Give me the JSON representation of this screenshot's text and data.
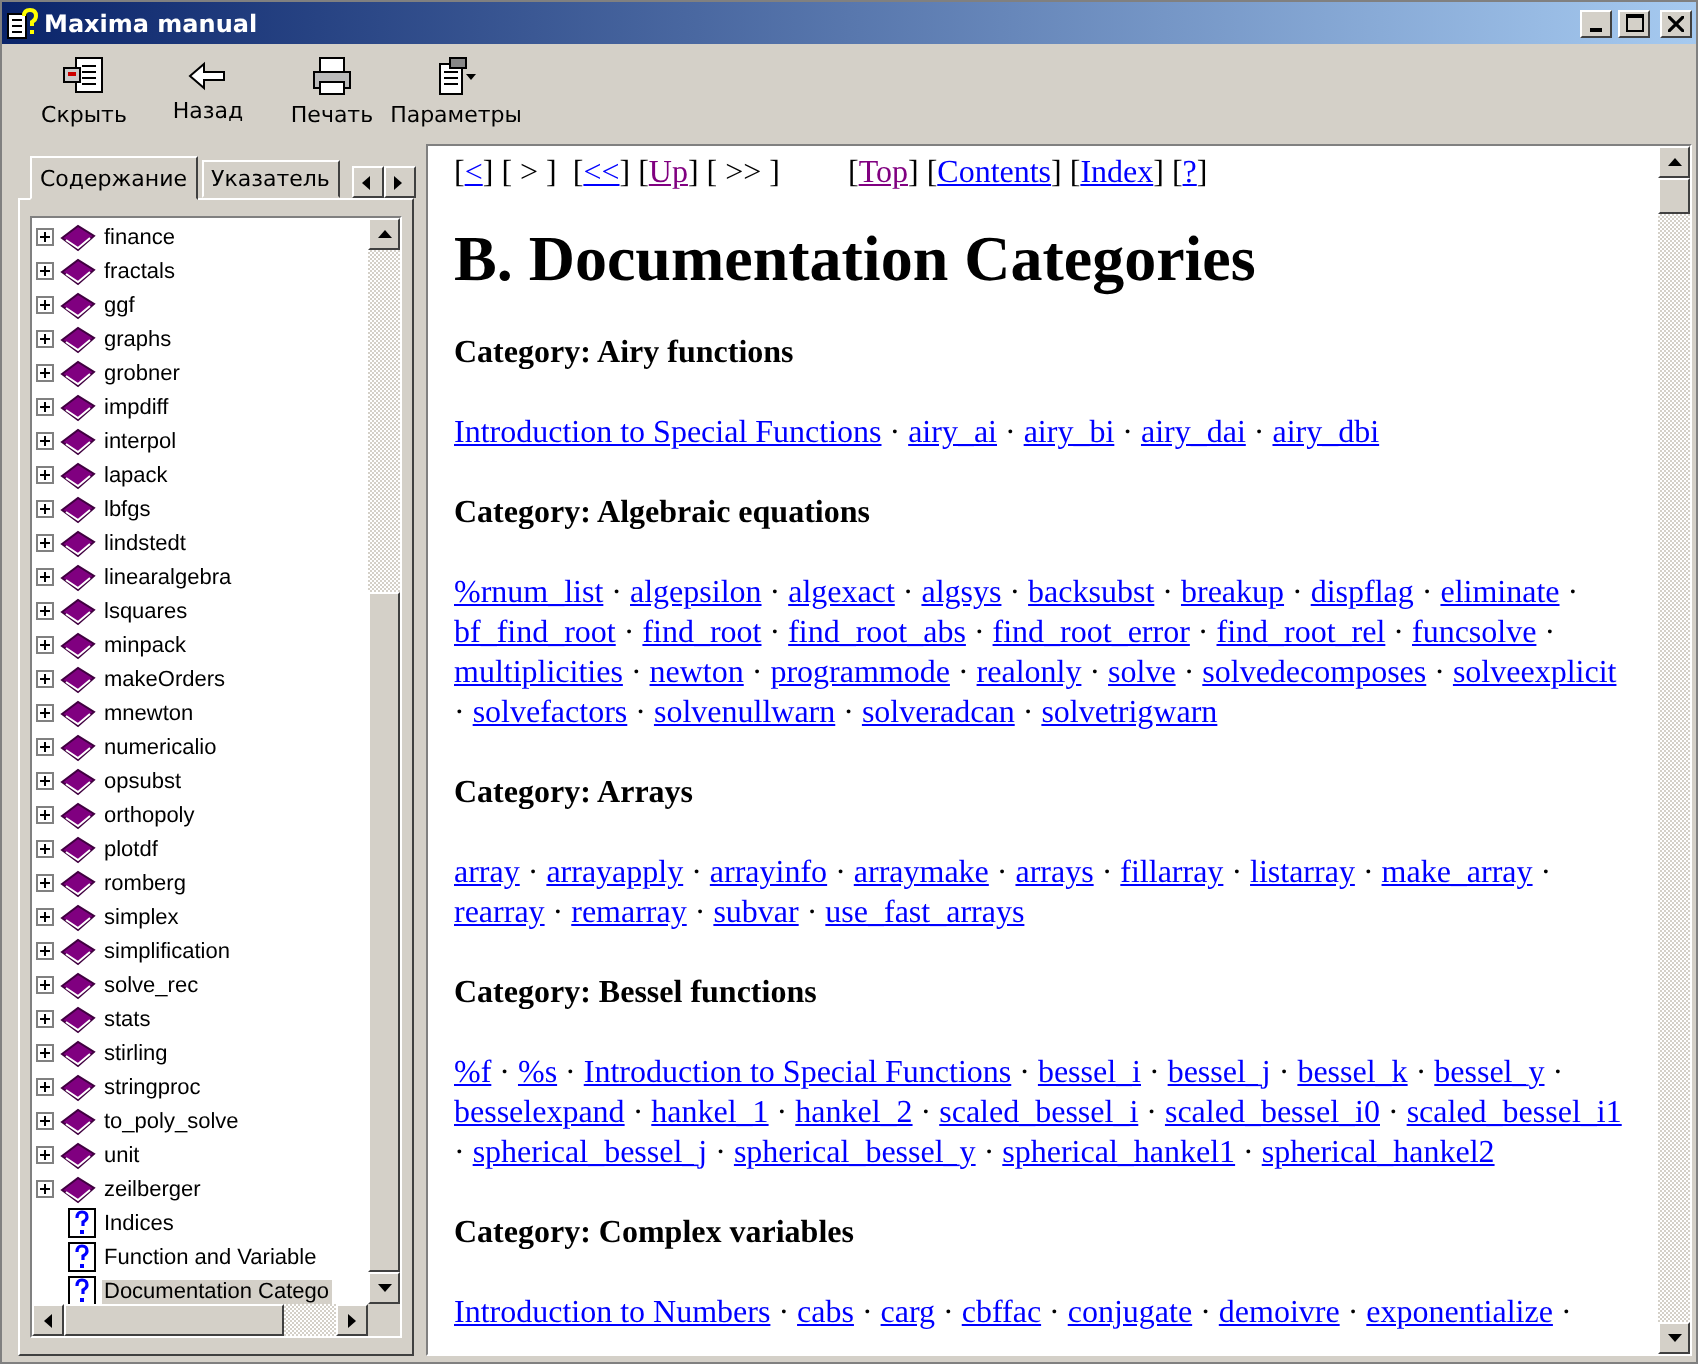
{
  "window": {
    "title": "Maxima manual"
  },
  "toolbar": [
    {
      "label": "Скрыть",
      "kind": "hide"
    },
    {
      "label": "Назад",
      "kind": "back"
    },
    {
      "label": "Печать",
      "kind": "print"
    },
    {
      "label": "Параметры",
      "kind": "options"
    }
  ],
  "tabs": [
    {
      "label": "Содержание",
      "selected": true
    },
    {
      "label": "Указатель",
      "selected": false
    }
  ],
  "tree": {
    "items": [
      {
        "label": "finance",
        "kind": "book",
        "selected": false
      },
      {
        "label": "fractals",
        "kind": "book",
        "selected": false
      },
      {
        "label": "ggf",
        "kind": "book",
        "selected": false
      },
      {
        "label": "graphs",
        "kind": "book",
        "selected": false
      },
      {
        "label": "grobner",
        "kind": "book",
        "selected": false
      },
      {
        "label": "impdiff",
        "kind": "book",
        "selected": false
      },
      {
        "label": "interpol",
        "kind": "book",
        "selected": false
      },
      {
        "label": "lapack",
        "kind": "book",
        "selected": false
      },
      {
        "label": "lbfgs",
        "kind": "book",
        "selected": false
      },
      {
        "label": "lindstedt",
        "kind": "book",
        "selected": false
      },
      {
        "label": "linearalgebra",
        "kind": "book",
        "selected": false
      },
      {
        "label": "lsquares",
        "kind": "book",
        "selected": false
      },
      {
        "label": "minpack",
        "kind": "book",
        "selected": false
      },
      {
        "label": "makeOrders",
        "kind": "book",
        "selected": false
      },
      {
        "label": "mnewton",
        "kind": "book",
        "selected": false
      },
      {
        "label": "numericalio",
        "kind": "book",
        "selected": false
      },
      {
        "label": "opsubst",
        "kind": "book",
        "selected": false
      },
      {
        "label": "orthopoly",
        "kind": "book",
        "selected": false
      },
      {
        "label": "plotdf",
        "kind": "book",
        "selected": false
      },
      {
        "label": "romberg",
        "kind": "book",
        "selected": false
      },
      {
        "label": "simplex",
        "kind": "book",
        "selected": false
      },
      {
        "label": "simplification",
        "kind": "book",
        "selected": false
      },
      {
        "label": "solve_rec",
        "kind": "book",
        "selected": false
      },
      {
        "label": "stats",
        "kind": "book",
        "selected": false
      },
      {
        "label": "stirling",
        "kind": "book",
        "selected": false
      },
      {
        "label": "stringproc",
        "kind": "book",
        "selected": false
      },
      {
        "label": "to_poly_solve",
        "kind": "book",
        "selected": false
      },
      {
        "label": "unit",
        "kind": "book",
        "selected": false
      },
      {
        "label": "zeilberger",
        "kind": "book",
        "selected": false
      },
      {
        "label": "Indices",
        "kind": "page",
        "selected": false
      },
      {
        "label": "Function and Variable",
        "kind": "page",
        "selected": false
      },
      {
        "label": "Documentation Catego",
        "kind": "page",
        "selected": true
      }
    ]
  },
  "nav": [
    [
      {
        "text": "[",
        "kind": "text"
      },
      {
        "text": "<",
        "kind": "link",
        "visited": false
      },
      {
        "text": "] [ > ]",
        "kind": "text"
      }
    ],
    [
      {
        "text": "[",
        "kind": "text"
      },
      {
        "text": "<<",
        "kind": "link",
        "visited": false
      },
      {
        "text": "] [",
        "kind": "text"
      },
      {
        "text": "Up",
        "kind": "link",
        "visited": true
      },
      {
        "text": "] [ >> ]",
        "kind": "text"
      }
    ],
    [
      {
        "text": "[",
        "kind": "text"
      },
      {
        "text": "Top",
        "kind": "link",
        "visited": true
      },
      {
        "text": "] [",
        "kind": "text"
      },
      {
        "text": "Contents",
        "kind": "link",
        "visited": false
      },
      {
        "text": "] [",
        "kind": "text"
      },
      {
        "text": "Index",
        "kind": "link",
        "visited": false
      },
      {
        "text": "] [",
        "kind": "text"
      },
      {
        "text": "?",
        "kind": "link",
        "visited": false
      },
      {
        "text": "]",
        "kind": "text"
      }
    ]
  ],
  "heading": "B. Documentation Categories",
  "separator": "·",
  "categories": [
    {
      "title": "Category: Airy functions",
      "links": [
        "Introduction to Special Functions",
        "airy_ai",
        "airy_bi",
        "airy_dai",
        "airy_dbi"
      ]
    },
    {
      "title": "Category: Algebraic equations",
      "links": [
        "%rnum_list",
        "algepsilon",
        "algexact",
        "algsys",
        "backsubst",
        "breakup",
        "dispflag",
        "eliminate",
        "bf_find_root",
        "find_root",
        "find_root_abs",
        "find_root_error",
        "find_root_rel",
        "funcsolve",
        "multiplicities",
        "newton",
        "programmode",
        "realonly",
        "solve",
        "solvedecomposes",
        "solveexplicit",
        "solvefactors",
        "solvenullwarn",
        "solveradcan",
        "solvetrigwarn"
      ]
    },
    {
      "title": "Category: Arrays",
      "links": [
        "array",
        "arrayapply",
        "arrayinfo",
        "arraymake",
        "arrays",
        "fillarray",
        "listarray",
        "make_array",
        "rearray",
        "remarray",
        "subvar",
        "use_fast_arrays"
      ]
    },
    {
      "title": "Category: Bessel functions",
      "links": [
        "%f",
        "%s",
        "Introduction to Special Functions",
        "bessel_i",
        "bessel_j",
        "bessel_k",
        "bessel_y",
        "besselexpand",
        "hankel_1",
        "hankel_2",
        "scaled_bessel_i",
        "scaled_bessel_i0",
        "scaled_bessel_i1",
        "spherical_bessel_j",
        "spherical_bessel_y",
        "spherical_hankel1",
        "spherical_hankel2"
      ]
    },
    {
      "title": "Category: Complex variables",
      "links": [
        "Introduction to Numbers",
        "cabs",
        "carg",
        "cbffac",
        "conjugate",
        "demoivre",
        "exponentialize"
      ],
      "trailing": true
    }
  ]
}
